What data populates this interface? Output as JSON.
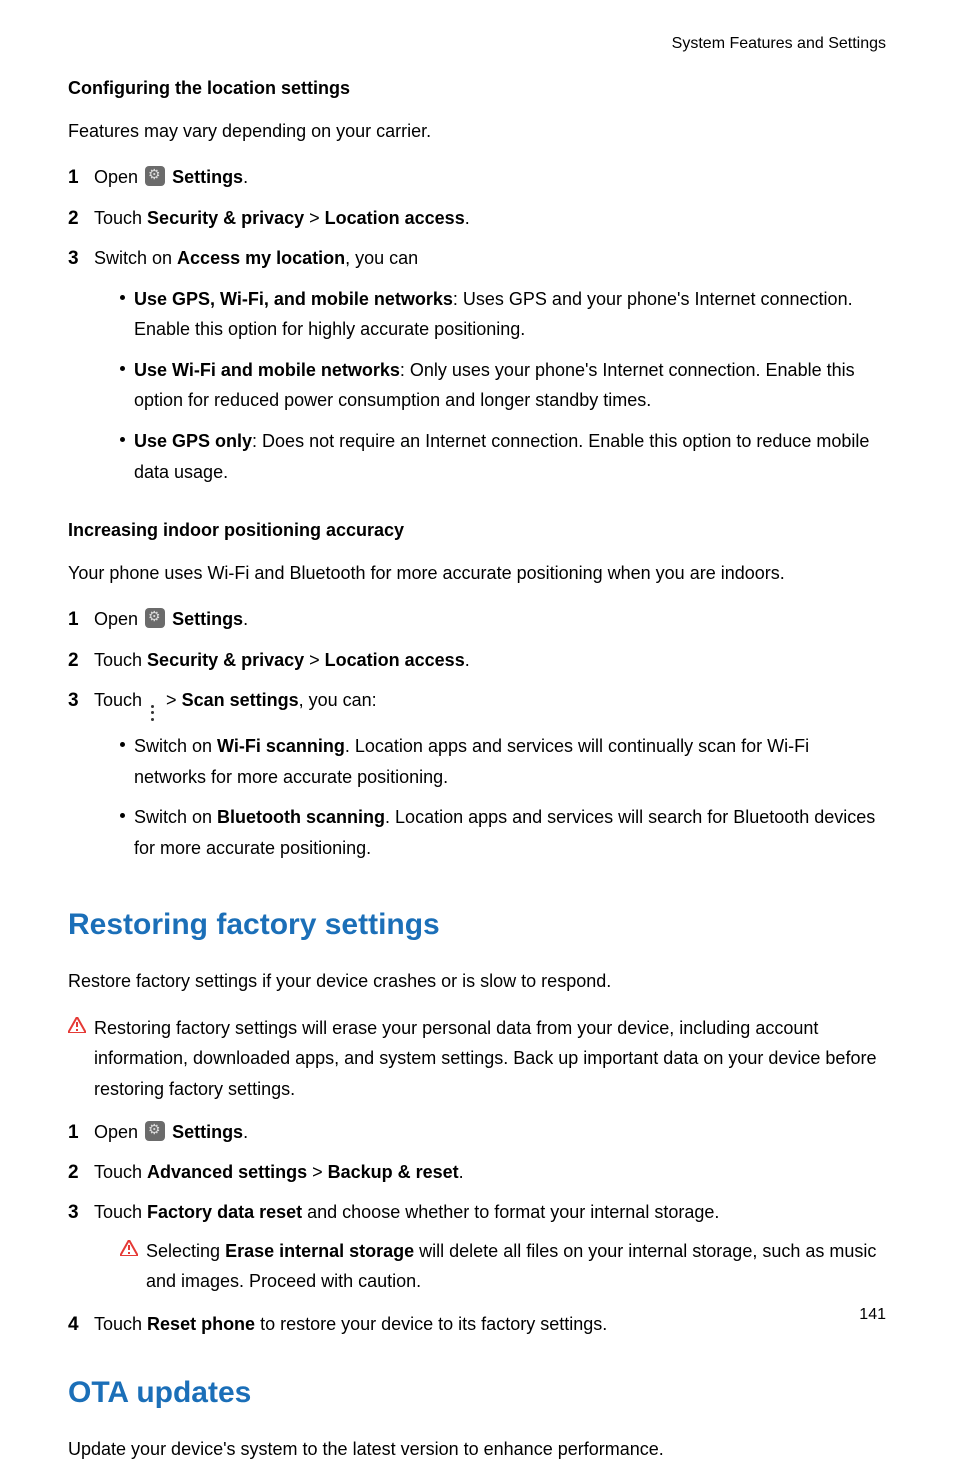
{
  "header": {
    "right": "System Features and Settings"
  },
  "sec1": {
    "title": "Configuring the location settings",
    "intro": "Features may vary depending on your carrier.",
    "step1_a": "Open ",
    "step1_settings": "Settings",
    "step1_b": ".",
    "step2_a": "Touch ",
    "step2_sp": "Security & privacy",
    "step2_gt": " > ",
    "step2_la": "Location access",
    "step2_b": ".",
    "step3_a": "Switch on ",
    "step3_aml": "Access my location",
    "step3_b": ", you can",
    "b1_a": "Use GPS, Wi-Fi, and mobile networks",
    "b1_b": ": Uses GPS and your phone's Internet connection. Enable this option for highly accurate positioning.",
    "b2_a": "Use Wi-Fi and mobile networks",
    "b2_b": ": Only uses your phone's Internet connection. Enable this option for reduced power consumption and longer standby times.",
    "b3_a": "Use GPS only",
    "b3_b": ": Does not require an Internet connection. Enable this option to reduce mobile data usage."
  },
  "sec2": {
    "title": "Increasing indoor positioning accuracy",
    "intro": "Your phone uses Wi-Fi and Bluetooth for more accurate positioning when you are indoors.",
    "step1_a": "Open ",
    "step1_settings": "Settings",
    "step1_b": ".",
    "step2_a": "Touch ",
    "step2_sp": "Security & privacy",
    "step2_gt": " > ",
    "step2_la": "Location access",
    "step2_b": ".",
    "step3_a": "Touch ",
    "step3_gt": " > ",
    "step3_ss": "Scan settings",
    "step3_b": ", you can:",
    "b1_a": "Switch on ",
    "b1_ws": "Wi-Fi scanning",
    "b1_b": ". Location apps and services will continually scan for Wi-Fi networks for more accurate positioning.",
    "b2_a": "Switch on ",
    "b2_bs": "Bluetooth scanning",
    "b2_b": ". Location apps and services will search for Bluetooth devices for more accurate positioning."
  },
  "sec3": {
    "heading": "Restoring factory settings",
    "intro": "Restore factory settings if your device crashes or is slow to respond.",
    "warn1": "Restoring factory settings will erase your personal data from your device, including account information, downloaded apps, and system settings. Back up important data on your device before restoring factory settings.",
    "step1_a": "Open ",
    "step1_settings": "Settings",
    "step1_b": ".",
    "step2_a": "Touch ",
    "step2_as": "Advanced settings",
    "step2_gt": " > ",
    "step2_br": "Backup & reset",
    "step2_b": ".",
    "step3_a": "Touch ",
    "step3_fdr": "Factory data reset",
    "step3_b": " and choose whether to format your internal storage.",
    "warn2_a": "Selecting ",
    "warn2_eis": "Erase internal storage",
    "warn2_b": " will delete all files on your internal storage, such as music and images. Proceed with caution.",
    "step4_a": "Touch ",
    "step4_rp": "Reset phone",
    "step4_b": " to restore your device to its factory settings."
  },
  "sec4": {
    "heading": "OTA updates",
    "intro": "Update your device's system to the latest version to enhance performance."
  },
  "page_number": "141"
}
